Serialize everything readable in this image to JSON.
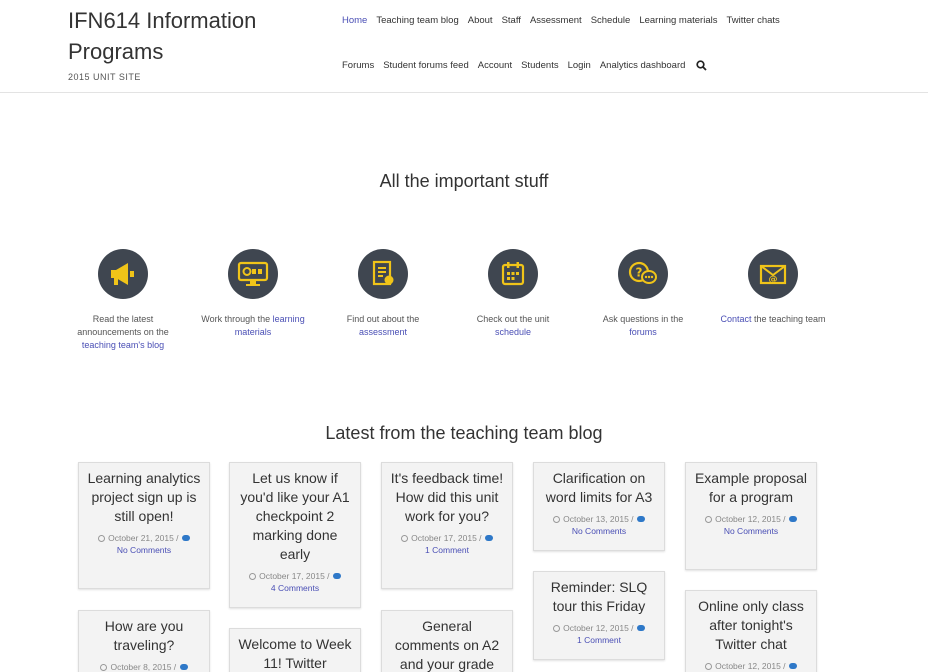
{
  "site": {
    "title": "IFN614 Information Programs",
    "subtitle": "2015 UNIT SITE"
  },
  "nav": {
    "row1": [
      "Home",
      "Teaching team blog",
      "About",
      "Staff",
      "Assessment",
      "Schedule",
      "Learning materials",
      "Twitter chats"
    ],
    "row2": [
      "Forums",
      "Student forums feed",
      "Account",
      "Students",
      "Login",
      "Analytics dashboard"
    ]
  },
  "sections": {
    "important": "All the important stuff",
    "blog": "Latest from the teaching team blog"
  },
  "features": [
    {
      "icon": "megaphone-icon",
      "pre": "Read the latest announcements on the ",
      "link": "teaching team's blog",
      "post": ""
    },
    {
      "icon": "learning-screen-icon",
      "pre": "Work through the ",
      "link": "learning materials",
      "post": ""
    },
    {
      "icon": "document-icon",
      "pre": "Find out about the ",
      "link": "assessment",
      "post": ""
    },
    {
      "icon": "calendar-icon",
      "pre": "Check out the unit ",
      "link": "schedule",
      "post": ""
    },
    {
      "icon": "chat-question-icon",
      "pre": "Ask questions in the ",
      "link": "",
      "post": "forums"
    },
    {
      "icon": "envelope-icon",
      "pre": "",
      "link": "Contact",
      "post": " the teaching team"
    }
  ],
  "accent": "#f0c419",
  "posts": {
    "p1": {
      "title": "Learning analytics project sign up is still open!",
      "date": "October 21, 2015",
      "comments": "No Comments"
    },
    "p2": {
      "title": "Let us know if you'd like your A1 checkpoint 2 marking done early",
      "date": "October 17, 2015",
      "comments": "4 Comments"
    },
    "p3": {
      "title": "It's feedback time! How did this unit work for you?",
      "date": "October 17, 2015",
      "comments": "1 Comment"
    },
    "p4": {
      "title": "Clarification on word limits for A3",
      "date": "October 13, 2015",
      "comments": "No Comments"
    },
    "p5": {
      "title": "Example proposal for a program",
      "date": "October 12, 2015",
      "comments": "No Comments"
    },
    "p6": {
      "title": "Reminder: SLQ tour this Friday",
      "date": "October 12, 2015",
      "comments": "1 Comment"
    },
    "p7": {
      "title": "How are you traveling?",
      "date": "October 8, 2015"
    },
    "p8": {
      "title": "Welcome to Week 11! Twitter"
    },
    "p9": {
      "title": "General comments on A2 and your grade"
    },
    "p10": {
      "title": "Online only class after tonight's Twitter chat",
      "date": "October 12, 2015"
    }
  }
}
